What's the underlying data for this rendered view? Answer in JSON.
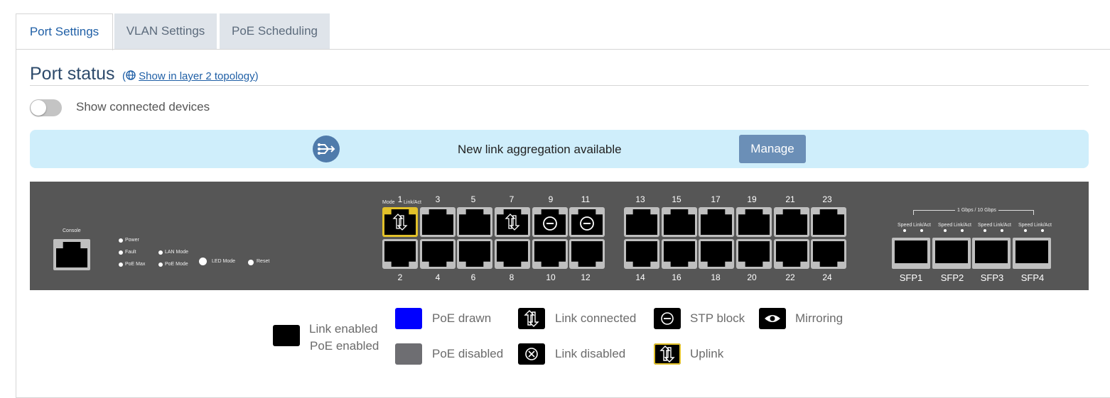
{
  "tabs": [
    {
      "label": "Port Settings",
      "active": true
    },
    {
      "label": "VLAN Settings",
      "active": false
    },
    {
      "label": "PoE Scheduling",
      "active": false
    }
  ],
  "header": {
    "title": "Port status",
    "topology_link": "Show in layer 2 topology",
    "paren_open": "(",
    "paren_close": ")"
  },
  "toggle": {
    "label": "Show connected devices",
    "on": false
  },
  "banner": {
    "text": "New link aggregation available",
    "button": "Manage",
    "icon": "link-aggregation-icon"
  },
  "switch_panel": {
    "console_label": "Console",
    "leds": {
      "power": "Power",
      "fault": "Fault",
      "poe_max": "PoE Max",
      "lan_mode": "LAN Mode",
      "poe_mode": "PoE Mode",
      "led_mode": "LED Mode",
      "reset": "Reset"
    },
    "port1_header": {
      "mode": "Mode",
      "link": "Link/Act"
    },
    "ports_top": [
      {
        "num": "1",
        "state": "uplink"
      },
      {
        "num": "3",
        "state": "enabled"
      },
      {
        "num": "5",
        "state": "enabled"
      },
      {
        "num": "7",
        "state": "connected"
      },
      {
        "num": "9",
        "state": "stp"
      },
      {
        "num": "11",
        "state": "stp"
      },
      {
        "num": "13",
        "state": "enabled"
      },
      {
        "num": "15",
        "state": "enabled"
      },
      {
        "num": "17",
        "state": "enabled"
      },
      {
        "num": "19",
        "state": "enabled"
      },
      {
        "num": "21",
        "state": "enabled"
      },
      {
        "num": "23",
        "state": "enabled"
      }
    ],
    "ports_bottom": [
      {
        "num": "2",
        "state": "enabled"
      },
      {
        "num": "4",
        "state": "enabled"
      },
      {
        "num": "6",
        "state": "enabled"
      },
      {
        "num": "8",
        "state": "enabled"
      },
      {
        "num": "10",
        "state": "enabled"
      },
      {
        "num": "12",
        "state": "enabled"
      },
      {
        "num": "14",
        "state": "enabled"
      },
      {
        "num": "16",
        "state": "enabled"
      },
      {
        "num": "18",
        "state": "enabled"
      },
      {
        "num": "20",
        "state": "enabled"
      },
      {
        "num": "22",
        "state": "enabled"
      },
      {
        "num": "24",
        "state": "enabled"
      }
    ],
    "sfp_header": "1 Gbps / 10 Gbps",
    "sfp_led_labels": {
      "speed": "Speed",
      "link": "Link/Act"
    },
    "sfp_ports": [
      "SFP1",
      "SFP2",
      "SFP3",
      "SFP4"
    ]
  },
  "legend": {
    "link_enabled_line1": "Link enabled",
    "link_enabled_line2": "PoE enabled",
    "poe_drawn": "PoE drawn",
    "poe_disabled": "PoE disabled",
    "link_connected": "Link connected",
    "link_disabled": "Link disabled",
    "stp_block": "STP block",
    "uplink": "Uplink",
    "mirroring": "Mirroring"
  },
  "colors": {
    "accent": "#1f5fa6",
    "banner_bg": "#cfeefb",
    "manage_button": "#6b8fb7",
    "switch_body": "#565656",
    "uplink_outline": "#e2c12a",
    "poe_drawn": "#0000ff",
    "poe_disabled": "#6e6e72"
  }
}
